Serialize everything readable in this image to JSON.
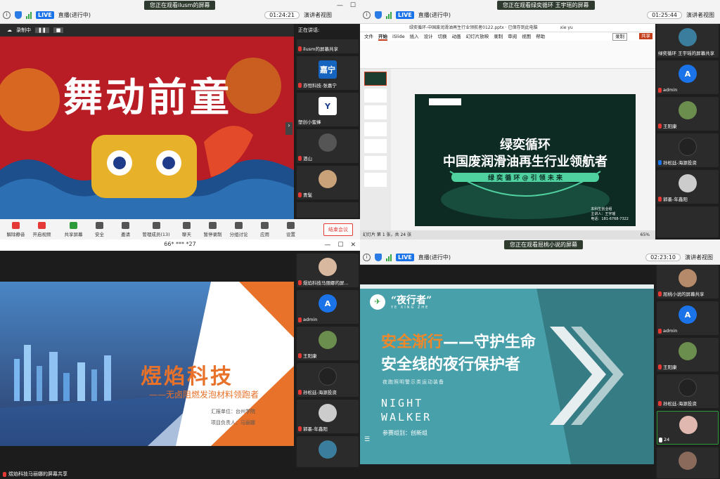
{
  "q1": {
    "banner": "您正在观看ilusm的屏幕",
    "rec": "录制中",
    "speaking": "正在讲话:",
    "slide_title": "舞动前童",
    "tiles": [
      "ilusm的屏幕共享",
      "亦恒科技-张嘉宁",
      "塑创小蜜蜂",
      "泗山",
      "青髦"
    ],
    "tile_avatar": "嘉宁",
    "controls": [
      "解除静音",
      "开启视频",
      "共享屏幕",
      "安全",
      "邀请",
      "管理成员(13)",
      "聊天",
      "暂停录制",
      "分组讨论",
      "应用",
      "设置"
    ],
    "end": "结束会议"
  },
  "q2": {
    "banner": "您正在观看绿奕循环 王宇瑶的屏幕",
    "live": "LIVE",
    "status": "直播(进行中)",
    "time": "01:25:44",
    "view": "演讲者视图",
    "ppt_file": "绿奕循环-中国废润滑油再生行业领航者0122.pptx",
    "ppt_status": "已保存到此电脑",
    "ppt_user": "xie yu",
    "ribbon_tabs": [
      "文件",
      "开始",
      "iSlide",
      "插入",
      "设计",
      "切换",
      "动画",
      "幻灯片放映",
      "录制",
      "审阅",
      "视图",
      "帮助"
    ],
    "record": "录制",
    "share": "共享",
    "slide_l1": "绿奕循环",
    "slide_l2": "中国废润滑油再生行业领航者",
    "slide_l3": "绿 奕 循 环 @ 引 领 未 来",
    "slide_info": [
      "本科生创业组",
      "主讲人：王宇瑶",
      "电话：181-6768-7322"
    ],
    "page_info": "幻灯片 第 1 张，共 24 张",
    "zoom": "65%",
    "tiles": [
      "绿奕循环 王宇瑶的屏幕共享",
      "admin",
      "王阳康",
      "孙松廷-海源投资",
      "郭墨-年鑫阳"
    ]
  },
  "q3": {
    "title": "66* *** *27",
    "slide_title": "煜焰科技",
    "slide_sub": "——无卤阻燃发泡材料领跑者",
    "unit": "汇报单位：台州学院",
    "lead": "项目负责人：马丽娜",
    "tiles": [
      "煜焰科技马丽娜的屏...",
      "admin",
      "王阳康",
      "孙松廷-海源投资",
      "郭墨-年鑫阳"
    ],
    "bottom_label": "煜焰科技马丽娜的屏幕共享"
  },
  "q4": {
    "banner": "您正在观看屈桃小说的屏幕",
    "live": "LIVE",
    "status": "直播(进行中)",
    "time": "02:23:10",
    "view": "演讲者视图",
    "brand": "“夜行者”",
    "brand_en": "YE XING ZHE",
    "slide_l1a": "安全渐行",
    "slide_l1b": "——守护生命",
    "slide_l2": "安全线的夜行保护者",
    "slide_sub": "夜跑照明警示类运动装备",
    "night": "NIGHT",
    "walker": "WALKER",
    "group": "参赛组别：创新组",
    "tiles": [
      "屈桃小说的屏幕共享",
      "admin",
      "王阳康",
      "孙松廷-海源投资",
      "24"
    ]
  },
  "q1bar": {
    "live": "LIVE",
    "status": "直播(进行中)",
    "time": "01:24:21",
    "view": "演讲者视图"
  }
}
